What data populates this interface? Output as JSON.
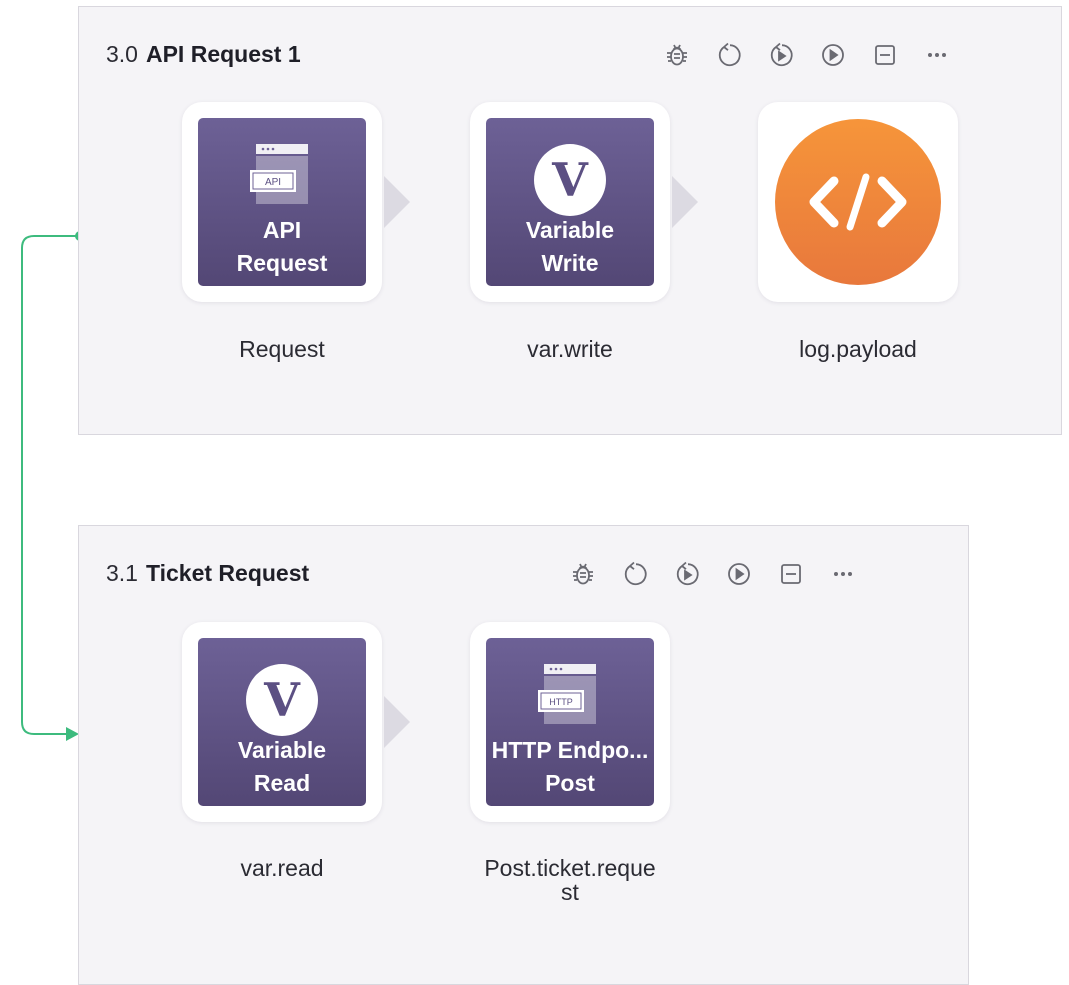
{
  "operations": [
    {
      "number": "3.0",
      "title": "API Request 1",
      "toolbar": [
        "bug-icon",
        "undo-icon",
        "run-from-here-icon",
        "play-icon",
        "collapse-icon",
        "more-icon"
      ],
      "components": [
        {
          "tile_lines": [
            "API",
            "Request"
          ],
          "badge": "API",
          "name": "Request"
        },
        {
          "tile_lines": [
            "Variable",
            "Write"
          ],
          "glyph": "V",
          "name": "var.write"
        },
        {
          "icon": "code-icon",
          "name": "log.payload"
        }
      ]
    },
    {
      "number": "3.1",
      "title": "Ticket Request",
      "toolbar": [
        "bug-icon",
        "undo-icon",
        "run-from-here-icon",
        "play-icon",
        "collapse-icon",
        "more-icon"
      ],
      "components": [
        {
          "tile_lines": [
            "Variable",
            "Read"
          ],
          "glyph": "V",
          "name": "var.read"
        },
        {
          "tile_lines": [
            "HTTP Endpo...",
            "Post"
          ],
          "badge": "HTTP",
          "name_lines": [
            "Post.ticket.reque",
            "st"
          ]
        }
      ]
    }
  ],
  "colors": {
    "tile": "#5f5388",
    "accent_orange": "#f0873a",
    "connector": "#3dbb7e",
    "panel_bg": "#f5f4f7"
  }
}
